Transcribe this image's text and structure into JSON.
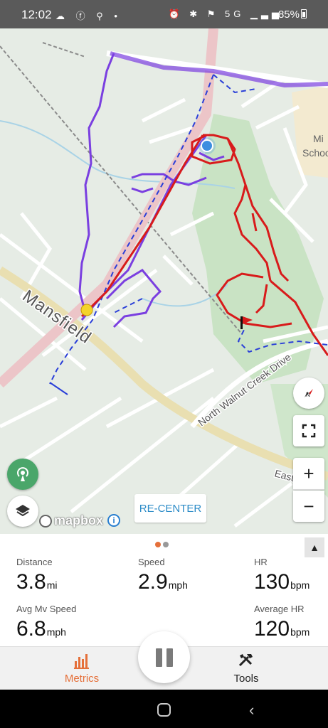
{
  "status_bar": {
    "time": "12:02",
    "left_icons": [
      "notification-icon",
      "facebook-icon",
      "cycling-icon",
      "dot"
    ],
    "right_icons": [
      "alarm-icon",
      "bluetooth-icon",
      "location-icon"
    ],
    "network": "5G",
    "battery": "85%"
  },
  "map": {
    "street_labels": [
      "Mansfield",
      "North Walnut Creek Drive",
      "East",
      "Mi",
      "Schoo"
    ],
    "attribution": "mapbox",
    "recenter_label": "RE-CENTER",
    "colors": {
      "past_track": "#7a3fe0",
      "current_track": "#d81b1b",
      "planned_route": "#2a3fd8",
      "position": "#3d8ee0"
    }
  },
  "metrics": {
    "pages": 2,
    "active_page": 1,
    "distance": {
      "label": "Distance",
      "value": "3.8",
      "unit": "mi"
    },
    "speed": {
      "label": "Speed",
      "value": "2.9",
      "unit": "mph"
    },
    "hr": {
      "label": "HR",
      "value": "130",
      "unit": "bpm"
    },
    "avg_speed": {
      "label": "Avg Mv Speed",
      "value": "6.8",
      "unit": "mph"
    },
    "avg_hr": {
      "label": "Average HR",
      "value": "120",
      "unit": "bpm"
    }
  },
  "tabs": {
    "metrics": "Metrics",
    "tools": "Tools",
    "accent": "#e5703a"
  }
}
